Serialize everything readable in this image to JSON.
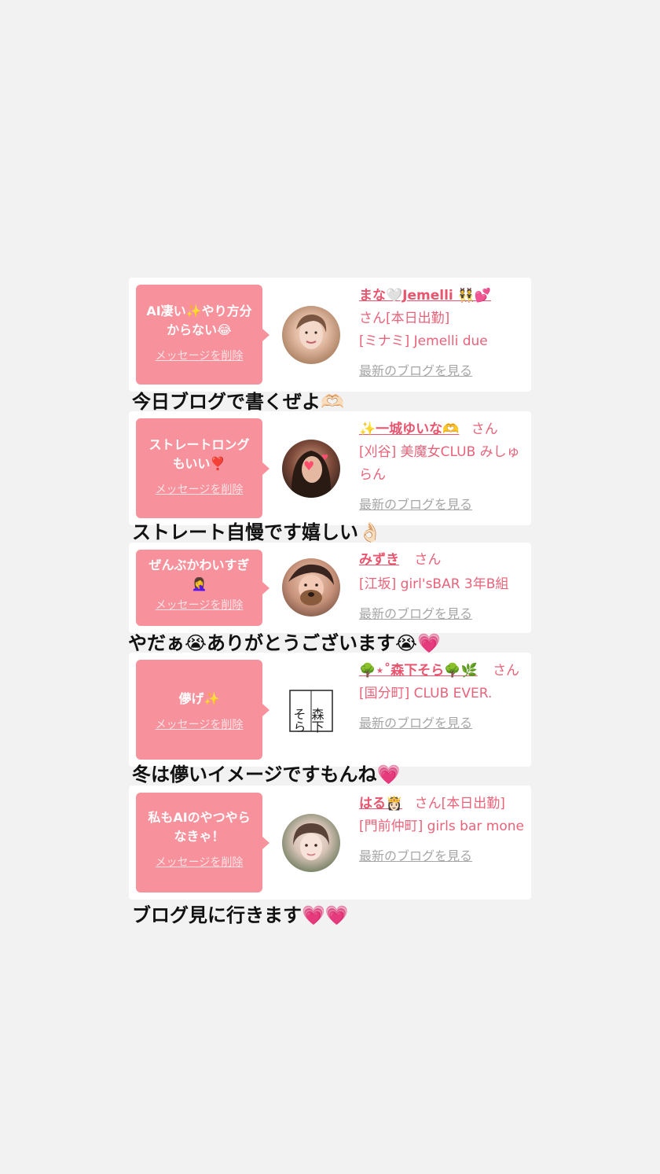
{
  "delete_label": "メッセージを削除",
  "blog_label": "最新のブログを見る",
  "san_label": "さん",
  "cards": [
    {
      "message": "AI凄い✨やり方分\nからない😂",
      "name": "まな🤍Jemelli 👯💕",
      "status": "[本日出勤]",
      "shop": "[ミナミ] Jemelli due",
      "caption": "今日ブログで書くぜよ🫶🏻"
    },
    {
      "message": "ストレートロング\nもいい❣️",
      "name": "✨一城ゆいな🫶",
      "status": "",
      "shop": "[刈谷] 美魔女CLUB みしゅらん",
      "caption": "ストレート自慢です嬉しい👌🏻"
    },
    {
      "message": "ぜんぶかわいすぎ\n🤦‍♀️",
      "name": "みずき",
      "status": "",
      "shop": "[江坂] girl'sBAR 3年B組",
      "caption": "やだぁ😭ありがとうございます😭💗"
    },
    {
      "message": "儚げ✨",
      "name": "🌳⋆˚森下そら🌳🌿",
      "status": "",
      "shop": "[国分町] CLUB EVER.",
      "caption": "冬は儚いイメージですもんね💗"
    },
    {
      "message": "私もAIのやつやら\nなきゃ！",
      "name": "はる👸🏻",
      "status": "[本日出勤]",
      "shop": "[門前仲町] girls bar mone",
      "caption": "ブログ見に行きます💗💗"
    }
  ],
  "logo_text": {
    "kanji": "森下",
    "kana": "そら"
  }
}
